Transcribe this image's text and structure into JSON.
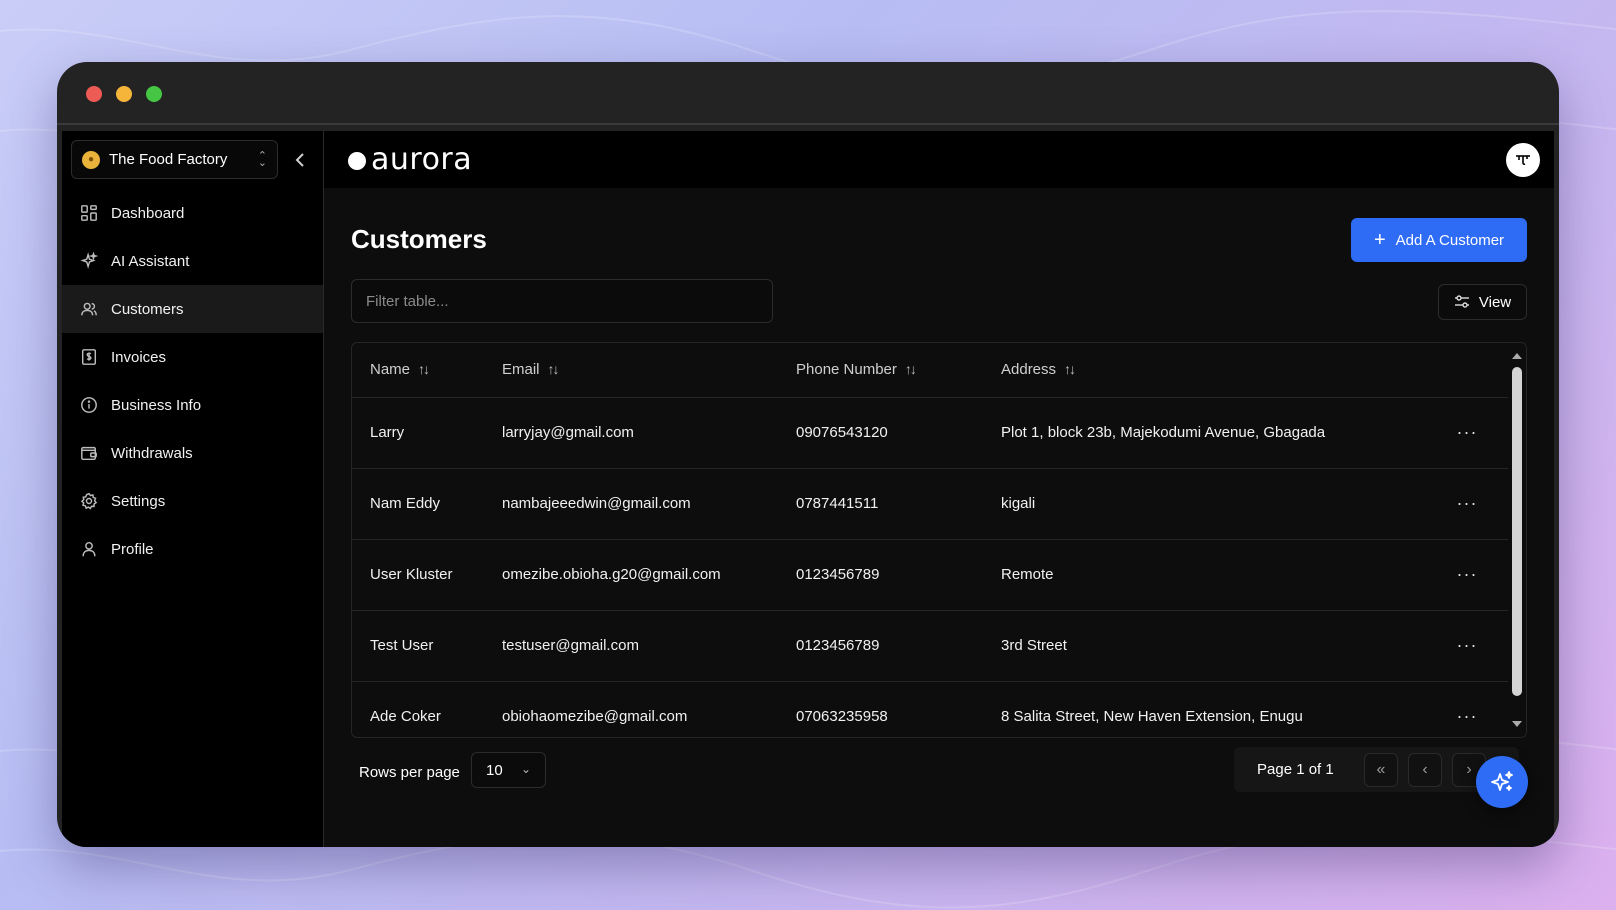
{
  "window": {
    "controls": [
      "close",
      "minimize",
      "maximize"
    ]
  },
  "org": {
    "name": "The Food Factory",
    "logo_icon": "org-logo-icon"
  },
  "brand": {
    "name": "aurora"
  },
  "sidebar": {
    "items": [
      {
        "label": "Dashboard",
        "icon": "dashboard-icon",
        "active": false
      },
      {
        "label": "AI Assistant",
        "icon": "sparkles-icon",
        "active": false
      },
      {
        "label": "Customers",
        "icon": "users-icon",
        "active": true
      },
      {
        "label": "Invoices",
        "icon": "invoice-icon",
        "active": false
      },
      {
        "label": "Business Info",
        "icon": "info-icon",
        "active": false
      },
      {
        "label": "Withdrawals",
        "icon": "wallet-icon",
        "active": false
      },
      {
        "label": "Settings",
        "icon": "gear-icon",
        "active": false
      },
      {
        "label": "Profile",
        "icon": "user-icon",
        "active": false
      }
    ]
  },
  "page": {
    "title": "Customers",
    "add_button_label": "Add A Customer",
    "filter_placeholder": "Filter table...",
    "view_button_label": "View"
  },
  "table": {
    "columns": [
      "Name",
      "Email",
      "Phone Number",
      "Address"
    ],
    "rows": [
      {
        "name": "Larry",
        "email": "larryjay@gmail.com",
        "phone": "09076543120",
        "address": "Plot 1, block 23b, Majekodumi Avenue, Gbagada"
      },
      {
        "name": "Nam Eddy",
        "email": "nambajeeedwin@gmail.com",
        "phone": "0787441511",
        "address": "kigali"
      },
      {
        "name": "User Kluster",
        "email": "omezibe.obioha.g20@gmail.com",
        "phone": "0123456789",
        "address": "Remote"
      },
      {
        "name": "Test User",
        "email": "testuser@gmail.com",
        "phone": "0123456789",
        "address": "3rd Street"
      },
      {
        "name": "Ade Coker",
        "email": "obiohaomezibe@gmail.com",
        "phone": "07063235958",
        "address": "8 Salita Street, New Haven Extension, Enugu"
      }
    ],
    "row_menu_glyph": "···"
  },
  "pagination": {
    "rows_per_page_label": "Rows per page",
    "rows_per_page_value": "10",
    "page_info": "Page 1 of 1"
  },
  "colors": {
    "accent": "#2e6cf6",
    "background": "#0d0d0d",
    "sidebar": "#000000"
  }
}
